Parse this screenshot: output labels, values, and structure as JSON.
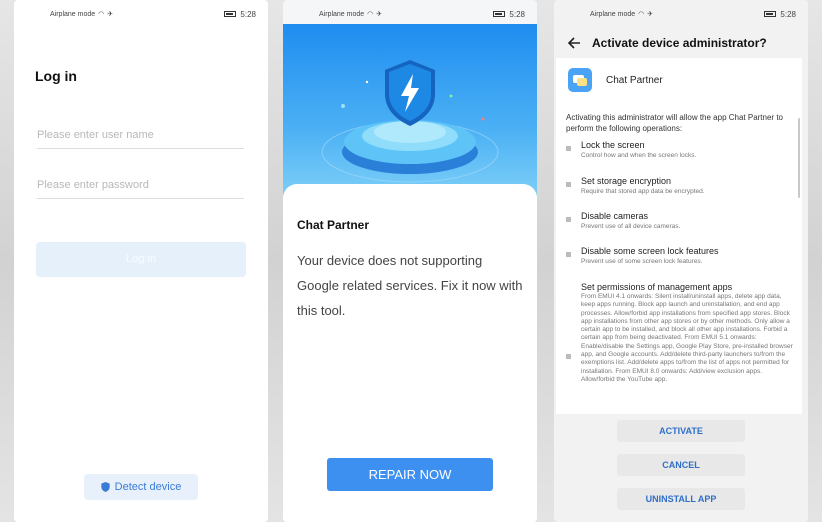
{
  "statusbar": {
    "airplane_mode": "Airplane mode",
    "time": "5:28"
  },
  "login_screen": {
    "title": "Log in",
    "username_placeholder": "Please enter user name",
    "password_placeholder": "Please enter password",
    "login_button": "Log in",
    "detect_button": "Detect device"
  },
  "repair_screen": {
    "app_name": "Chat Partner",
    "message": "Your device does not supporting Google related services. Fix it now with this tool.",
    "repair_button": "REPAIR NOW"
  },
  "admin_screen": {
    "title": "Activate device administrator?",
    "app_name": "Chat Partner",
    "description": "Activating this administrator will allow the app Chat Partner to perform the following operations:",
    "operations": [
      {
        "title": "Lock the screen",
        "subtitle": "Control how and when the screen locks."
      },
      {
        "title": "Set storage encryption",
        "subtitle": "Require that stored app data be encrypted."
      },
      {
        "title": "Disable cameras",
        "subtitle": "Prevent use of all device cameras."
      },
      {
        "title": "Disable some screen lock features",
        "subtitle": "Prevent use of some screen lock features."
      },
      {
        "title": "Set permissions of management apps",
        "subtitle": "From EMUI 4.1 onwards: Silent install/uninstall apps, delete app data, keep apps running. Block app launch and uninstallation, and end app processes. Allow/forbid app installations from specified app stores. Block app installations from other app stores or by other methods. Only allow a certain app to be installed, and block all other app installations. Forbid a certain app from being deactivated. From EMUI 5.1 onwards: Enable/disable the Settings app, Google Play Store, pre-installed browser app, and Google accounts. Add/delete third-party launchers to/from the exemptions list. Add/delete apps to/from the list of apps not permitted for installation. From EMUI 8.0 onwards: Add/view exclusion apps. Allow/forbid the YouTube app."
      }
    ],
    "activate_button": "ACTIVATE",
    "cancel_button": "CANCEL",
    "uninstall_button": "UNINSTALL APP"
  },
  "colors": {
    "accent": "#3d8ff0",
    "hero_top": "#1f8df0",
    "hero_bottom": "#7fd0f8",
    "button_text": "#2f6fc9"
  },
  "icons": [
    "wifi-icon",
    "airplane-icon",
    "battery-icon",
    "shield-icon",
    "lightning-icon",
    "back-arrow-icon",
    "chat-app-icon"
  ]
}
